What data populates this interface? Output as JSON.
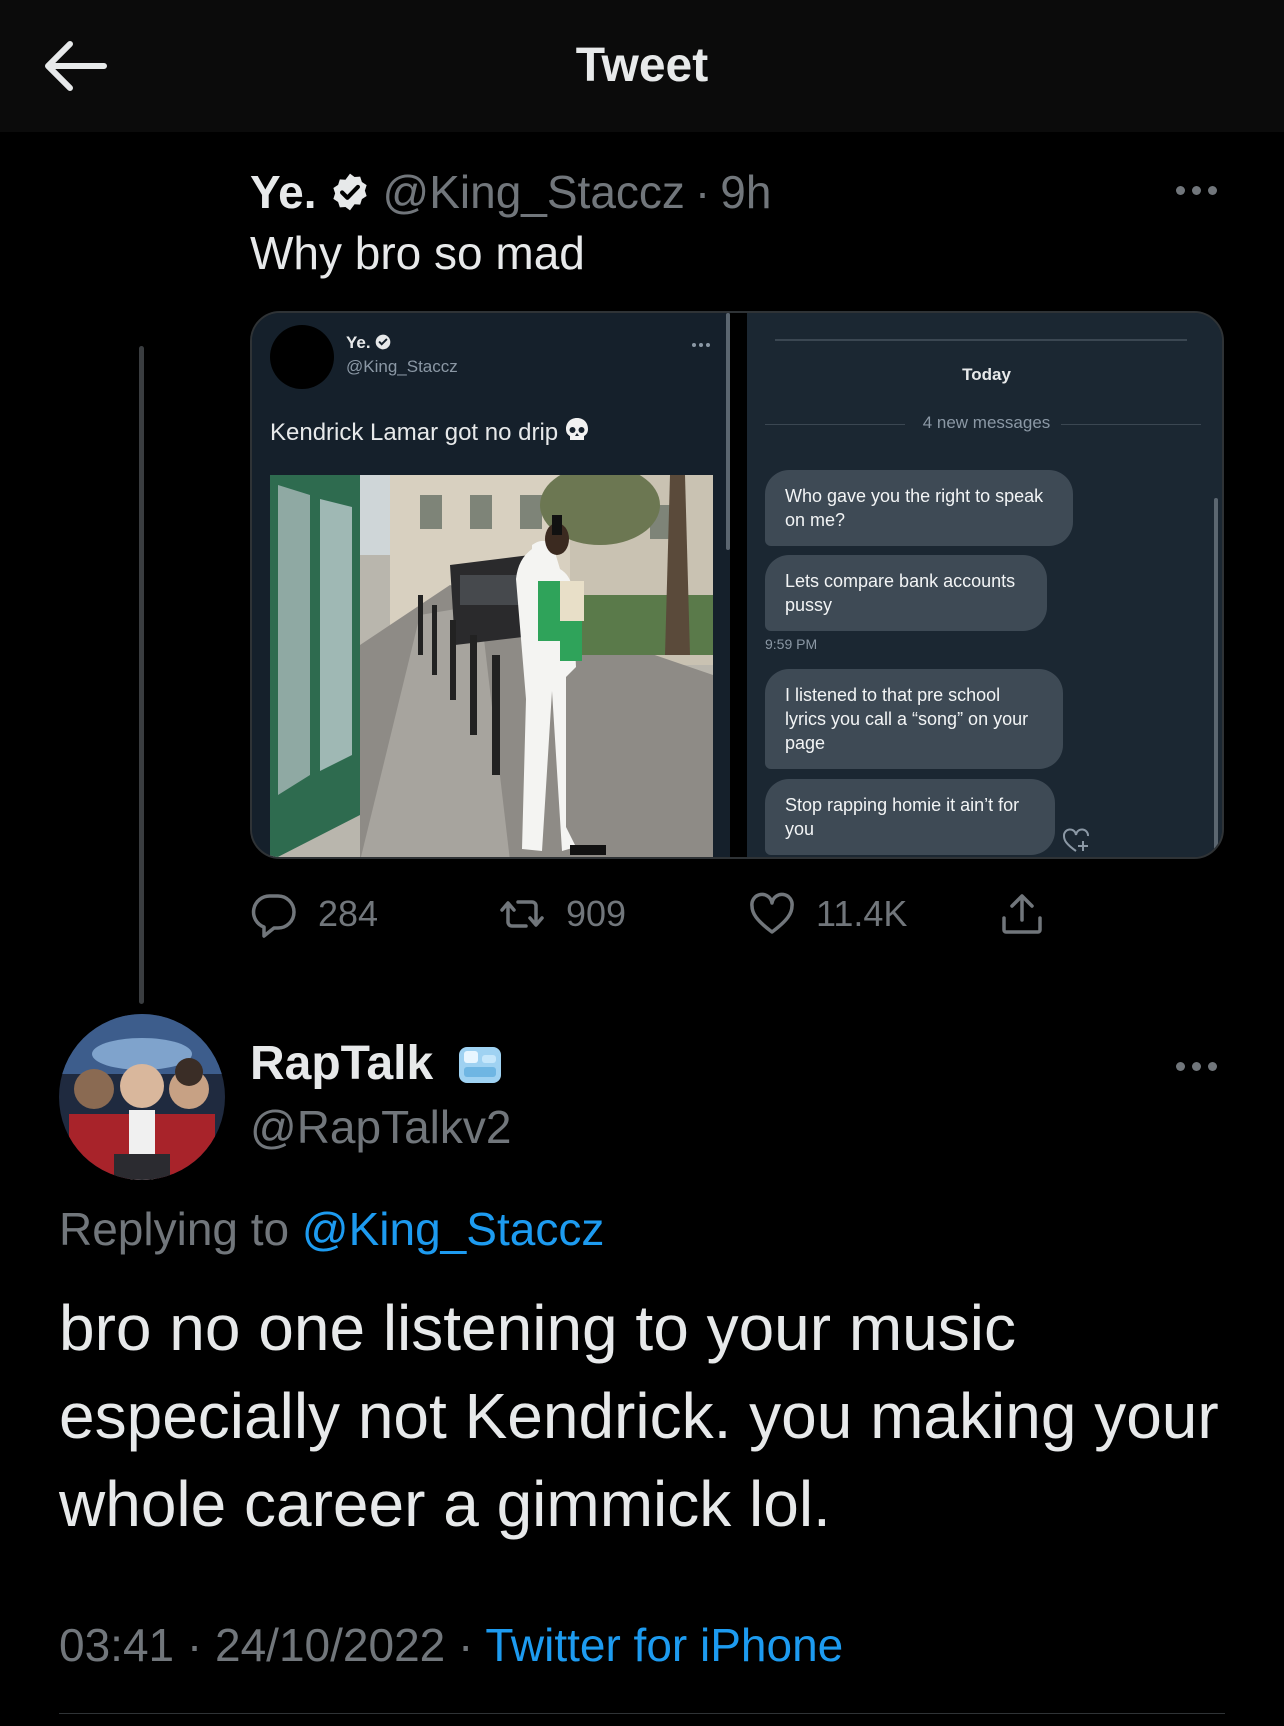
{
  "header": {
    "title": "Tweet",
    "back_icon": "arrow-left-icon"
  },
  "parent_tweet": {
    "name": "Ye.",
    "verified": true,
    "handle": "@King_Staccz",
    "separator": "·",
    "time": "9h",
    "text": "Why bro so mad",
    "media": {
      "left_screenshot": {
        "name": "Ye.",
        "handle": "@King_Staccz",
        "text": "Kendrick Lamar got no drip"
      },
      "right_screenshot": {
        "date_label": "Today",
        "new_messages_label": "4 new messages",
        "messages": [
          "Who gave you the right to speak on me?",
          "Lets compare bank accounts pussy",
          "I listened to that pre school lyrics you call a “song” on your page",
          "Stop rapping homie it ain’t for you"
        ],
        "timestamp": "9:59 PM"
      }
    },
    "actions": {
      "replies": "284",
      "retweets": "909",
      "likes": "11.4K"
    }
  },
  "reply_tweet": {
    "name": "RapTalk",
    "emoji": "ice-cube-emoji",
    "handle": "@RapTalkv2",
    "replying_prefix": "Replying to",
    "replying_to": "@King_Staccz",
    "text": "bro no one listening to your music especially not Kendrick. you making your whole career a gimmick lol.",
    "time": "03:41",
    "date": "24/10/2022",
    "separator": "·",
    "source": "Twitter for iPhone"
  },
  "colors": {
    "background": "#000000",
    "text": "#e7e9ea",
    "muted": "#71767b",
    "link": "#1d9bf0"
  }
}
